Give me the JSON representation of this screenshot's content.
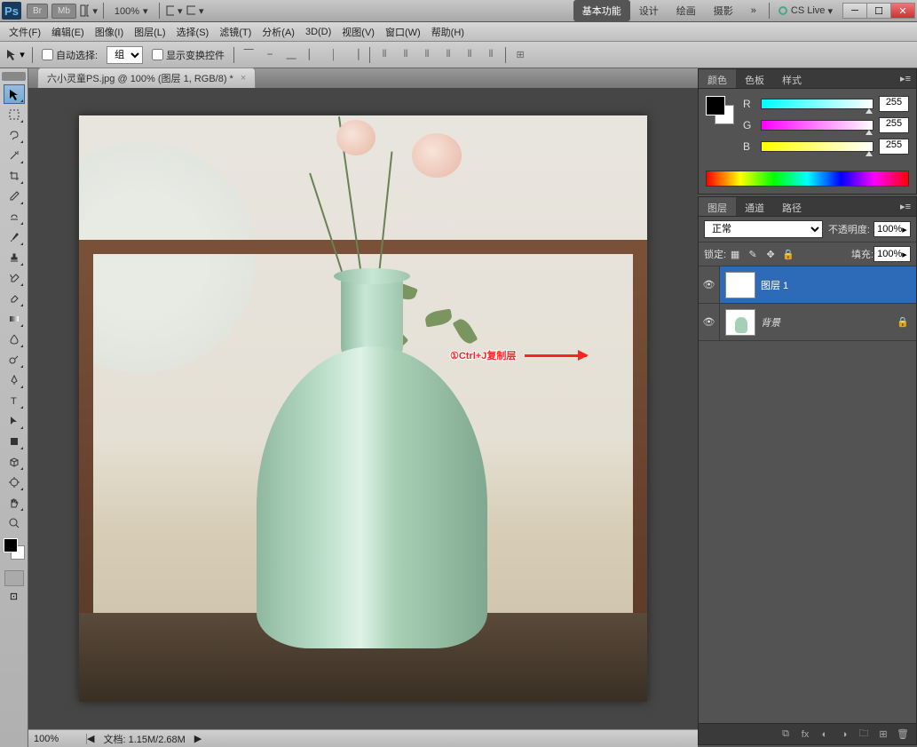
{
  "app": {
    "logo": "Ps"
  },
  "titlebar": {
    "buttons": {
      "br": "Br",
      "mb": "Mb"
    },
    "zoom": "100%",
    "workspaces": [
      "基本功能",
      "设计",
      "绘画",
      "摄影"
    ],
    "cslive": "CS Live"
  },
  "menus": [
    "文件(F)",
    "编辑(E)",
    "图像(I)",
    "图层(L)",
    "选择(S)",
    "滤镜(T)",
    "分析(A)",
    "3D(D)",
    "视图(V)",
    "窗口(W)",
    "帮助(H)"
  ],
  "options": {
    "auto_select": "自动选择:",
    "group": "组",
    "show_transform": "显示变换控件"
  },
  "document": {
    "tab": "六小灵童PS.jpg @ 100% (图层 1, RGB/8) *",
    "status_zoom": "100%",
    "status_info": "文档: 1.15M/2.68M"
  },
  "annotation": "①Ctrl+J复制层",
  "panels": {
    "color": {
      "tabs": [
        "颜色",
        "色板",
        "样式"
      ],
      "channels": [
        {
          "label": "R",
          "value": "255"
        },
        {
          "label": "G",
          "value": "255"
        },
        {
          "label": "B",
          "value": "255"
        }
      ]
    },
    "layers": {
      "tabs": [
        "图层",
        "通道",
        "路径"
      ],
      "blend_mode": "正常",
      "opacity_label": "不透明度:",
      "opacity_value": "100%",
      "lock_label": "锁定:",
      "fill_label": "填充:",
      "fill_value": "100%",
      "list": [
        {
          "name": "图层 1",
          "selected": true,
          "locked": false
        },
        {
          "name": "背景",
          "selected": false,
          "locked": true
        }
      ]
    }
  }
}
